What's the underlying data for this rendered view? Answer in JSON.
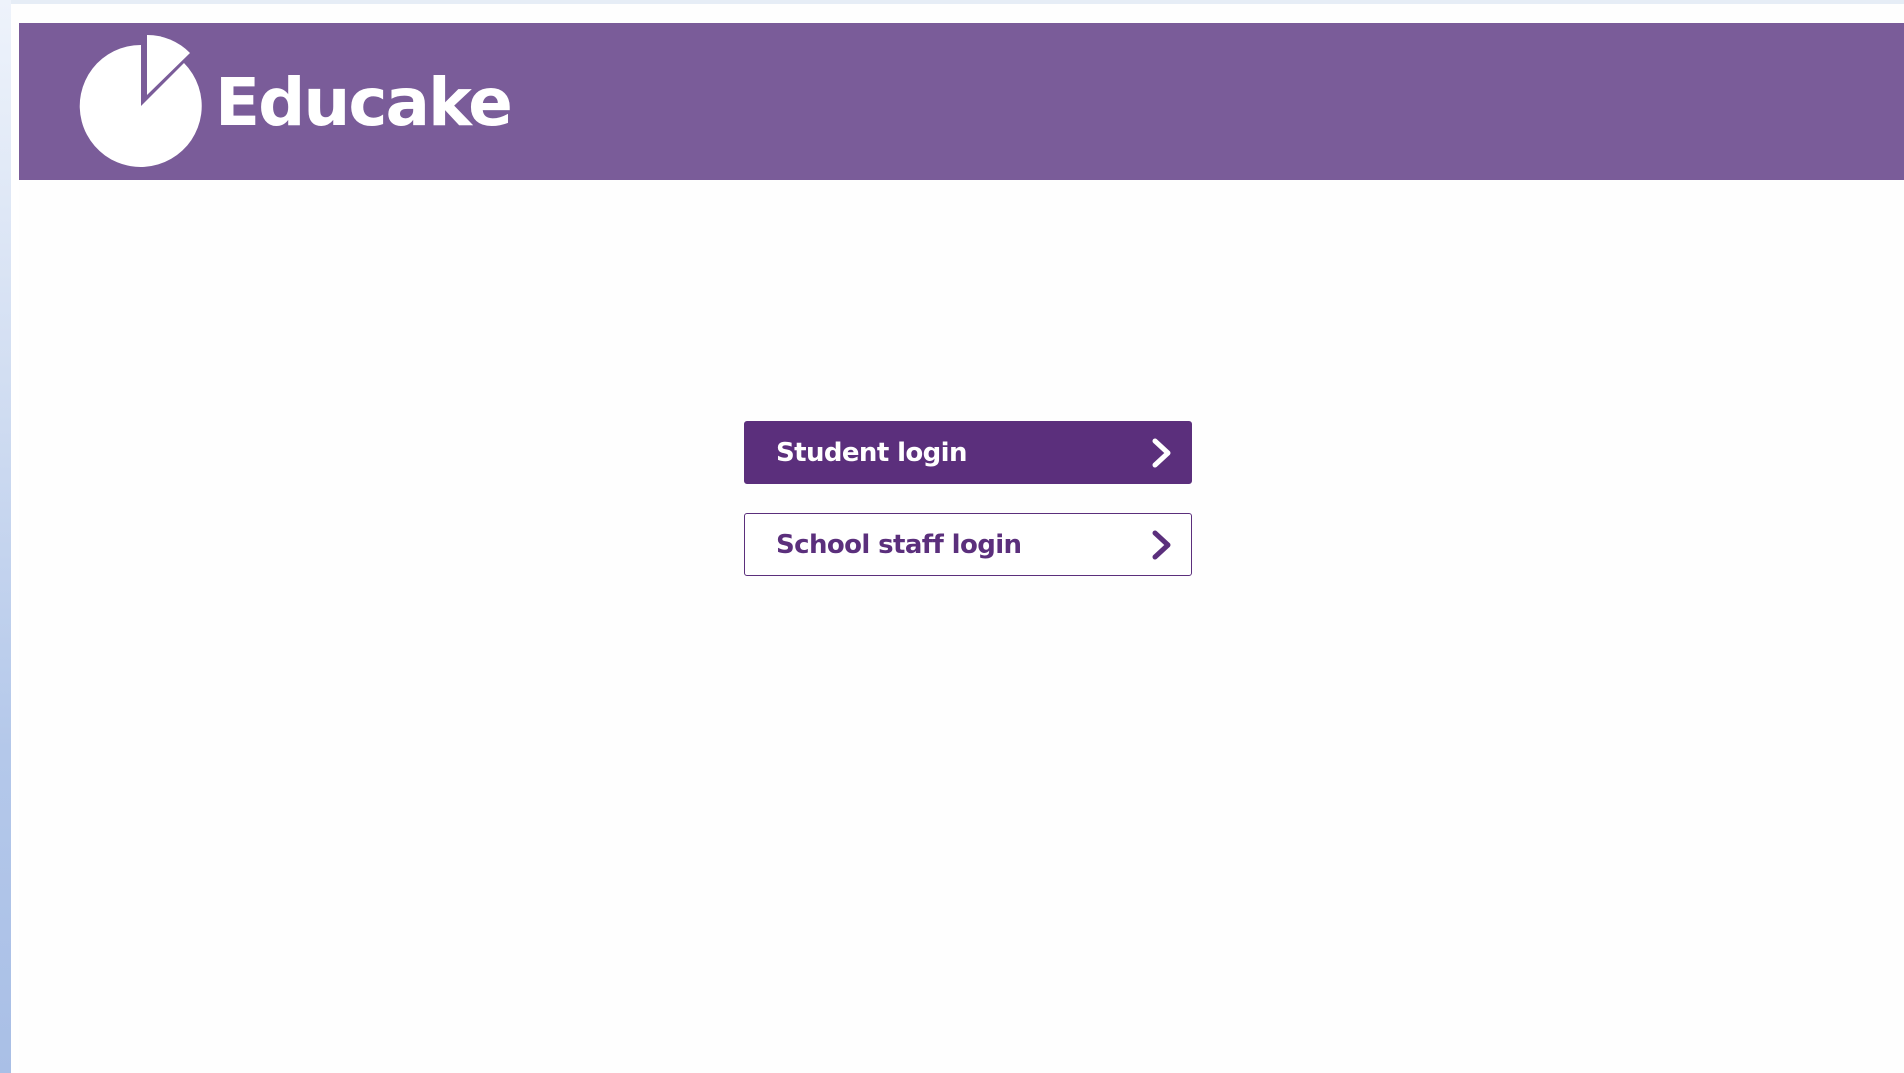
{
  "header": {
    "brand_name": "Educake",
    "logo_icon": "pie-chart-icon",
    "background_color": "#7a5c99"
  },
  "login": {
    "student_label": "Student login",
    "staff_label": "School staff login",
    "chevron_icon": "chevron-right-icon",
    "accent_color": "#5b2f7c"
  }
}
